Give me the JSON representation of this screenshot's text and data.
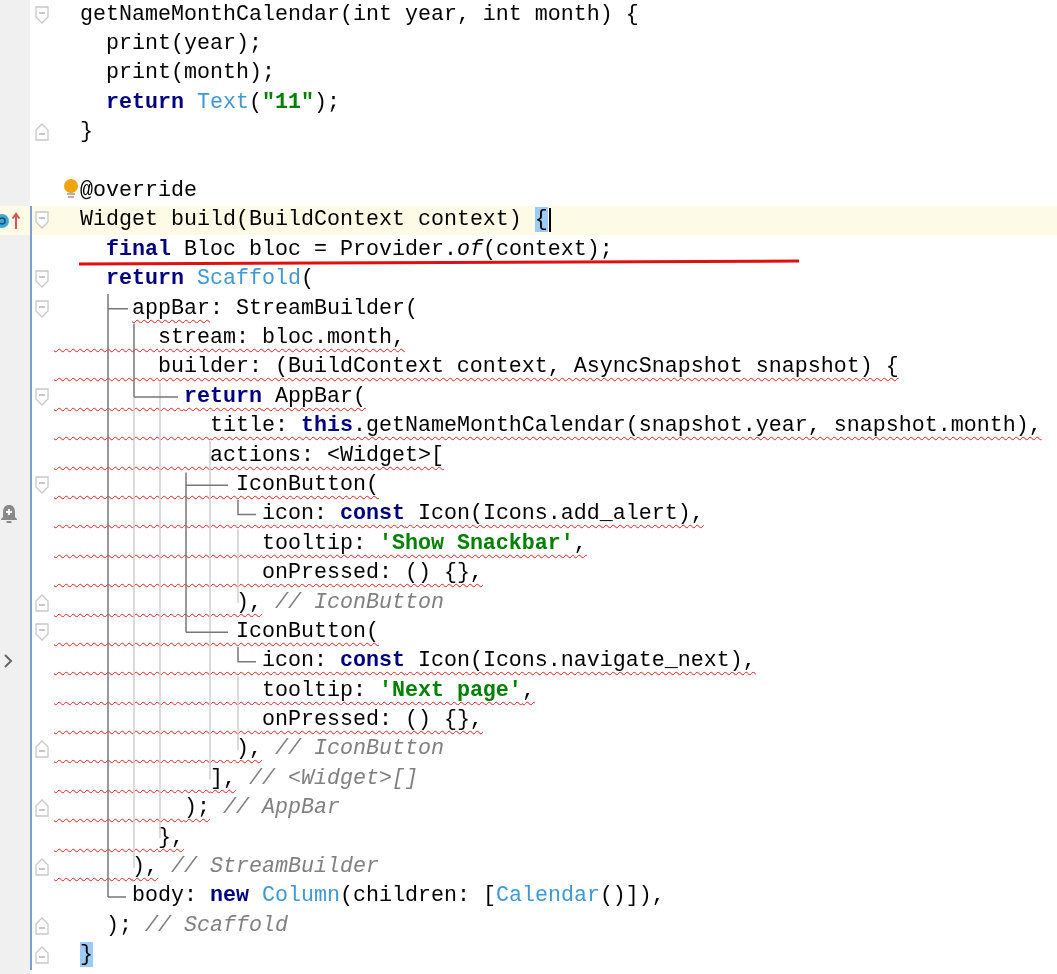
{
  "editor": {
    "lines": [
      {
        "tokens": [
          {
            "text": "  getNameMonthCalendar(int year, int month) {"
          }
        ],
        "fold_start": true,
        "fold_end": false,
        "current": false,
        "changed": false,
        "squiggle": false,
        "intention": false,
        "caret": false
      },
      {
        "tokens": [
          {
            "text": "    print(year);"
          }
        ],
        "fold_start": false,
        "fold_end": false,
        "current": false,
        "changed": false,
        "squiggle": false,
        "intention": false,
        "caret": false
      },
      {
        "tokens": [
          {
            "text": "    print(month);"
          }
        ],
        "fold_start": false,
        "fold_end": false,
        "current": false,
        "changed": false,
        "squiggle": false,
        "intention": false,
        "caret": false
      },
      {
        "tokens": [
          {
            "text": "    return",
            "kind": "keyword"
          },
          {
            "text": " Text",
            "kind": "type"
          },
          {
            "text": "("
          },
          {
            "text": "\"11\"",
            "kind": "string"
          },
          {
            "text": ");"
          }
        ],
        "fold_start": false,
        "fold_end": false,
        "current": false,
        "changed": false,
        "squiggle": false,
        "intention": false,
        "caret": false
      },
      {
        "tokens": [
          {
            "text": "  }"
          }
        ],
        "fold_start": false,
        "fold_end": true,
        "current": false,
        "changed": false,
        "squiggle": false,
        "intention": false,
        "caret": false
      },
      {
        "fold_start": false,
        "fold_end": false,
        "current": false,
        "changed": false,
        "squiggle": false,
        "intention": false,
        "caret": false
      },
      {
        "tokens": [
          {
            "text": "  @override"
          }
        ],
        "fold_start": false,
        "fold_end": false,
        "current": false,
        "changed": false,
        "squiggle": false,
        "intention": true,
        "caret": false
      },
      {
        "tokens": [
          {
            "text": "  Widget build(BuildContext context) "
          },
          {
            "text": "{",
            "kind": "match"
          }
        ],
        "fold_start": true,
        "fold_end": false,
        "current": true,
        "changed": true,
        "squiggle": false,
        "intention": false,
        "caret": true
      },
      {
        "tokens": [
          {
            "text": "    final",
            "kind": "keyword"
          },
          {
            "text": " Bloc bloc = Provider."
          },
          {
            "text": "of",
            "kind": "italic"
          },
          {
            "text": "(context);"
          }
        ],
        "fold_start": false,
        "fold_end": false,
        "current": false,
        "changed": true,
        "squiggle": false,
        "intention": false,
        "caret": false
      },
      {
        "tokens": [
          {
            "text": "    return",
            "kind": "keyword"
          },
          {
            "text": " Scaffold",
            "kind": "type"
          },
          {
            "text": "("
          }
        ],
        "fold_start": true,
        "fold_end": false,
        "current": false,
        "changed": true,
        "squiggle": false,
        "intention": false,
        "caret": false
      },
      {
        "tokens": [
          {
            "text": "      appBar",
            "error": true
          },
          {
            "text": ": StreamBuilder("
          }
        ],
        "fold_start": true,
        "fold_end": false,
        "current": false,
        "changed": true,
        "squiggle": false,
        "intention": false,
        "caret": false
      },
      {
        "tokens": [
          {
            "text": "        stream: bloc.month,"
          }
        ],
        "fold_start": false,
        "fold_end": false,
        "current": false,
        "changed": true,
        "squiggle": true,
        "intention": false,
        "caret": false
      },
      {
        "tokens": [
          {
            "text": "        builder: (BuildContext context, AsyncSnapshot snapshot) {"
          }
        ],
        "fold_start": false,
        "fold_end": false,
        "current": false,
        "changed": true,
        "squiggle": true,
        "intention": false,
        "caret": false
      },
      {
        "tokens": [
          {
            "text": "          return",
            "kind": "keyword"
          },
          {
            "text": " AppBar("
          }
        ],
        "fold_start": true,
        "fold_end": false,
        "current": false,
        "changed": true,
        "squiggle": true,
        "intention": false,
        "caret": false
      },
      {
        "tokens": [
          {
            "text": "            title: "
          },
          {
            "text": "this",
            "kind": "keyword"
          },
          {
            "text": ".getNameMonthCalendar(snapshot.year, snapshot.month),"
          }
        ],
        "fold_start": false,
        "fold_end": false,
        "current": false,
        "changed": true,
        "squiggle": true,
        "intention": false,
        "caret": false
      },
      {
        "tokens": [
          {
            "text": "            actions: <Widget>["
          }
        ],
        "fold_start": false,
        "fold_end": false,
        "current": false,
        "changed": true,
        "squiggle": true,
        "intention": false,
        "caret": false
      },
      {
        "tokens": [
          {
            "text": "              IconButton("
          }
        ],
        "fold_start": true,
        "fold_end": false,
        "current": false,
        "changed": true,
        "squiggle": true,
        "intention": false,
        "caret": false
      },
      {
        "tokens": [
          {
            "text": "                icon: "
          },
          {
            "text": "const",
            "kind": "keyword"
          },
          {
            "text": " Icon(Icons.add_alert),"
          }
        ],
        "fold_start": false,
        "fold_end": false,
        "current": false,
        "changed": true,
        "squiggle": true,
        "intention": false,
        "caret": false
      },
      {
        "tokens": [
          {
            "text": "                tooltip: "
          },
          {
            "text": "'Show Snackbar'",
            "kind": "string"
          },
          {
            "text": ","
          }
        ],
        "fold_start": false,
        "fold_end": false,
        "current": false,
        "changed": true,
        "squiggle": true,
        "intention": false,
        "caret": false
      },
      {
        "tokens": [
          {
            "text": "                onPressed: () {},"
          }
        ],
        "fold_start": false,
        "fold_end": false,
        "current": false,
        "changed": true,
        "squiggle": true,
        "intention": false,
        "caret": false
      },
      {
        "tokens": [
          {
            "text": "              ),"
          },
          {
            "text": " // IconButton",
            "kind": "comment"
          }
        ],
        "fold_start": false,
        "fold_end": true,
        "current": false,
        "changed": true,
        "squiggle": true,
        "intention": false,
        "caret": false
      },
      {
        "tokens": [
          {
            "text": "              IconButton("
          }
        ],
        "fold_start": true,
        "fold_end": false,
        "current": false,
        "changed": true,
        "squiggle": true,
        "intention": false,
        "caret": false
      },
      {
        "tokens": [
          {
            "text": "                icon: "
          },
          {
            "text": "const",
            "kind": "keyword"
          },
          {
            "text": " Icon(Icons.navigate_next),"
          }
        ],
        "fold_start": false,
        "fold_end": false,
        "current": false,
        "changed": true,
        "squiggle": true,
        "intention": false,
        "caret": false
      },
      {
        "tokens": [
          {
            "text": "                tooltip: "
          },
          {
            "text": "'Next page'",
            "kind": "string"
          },
          {
            "text": ","
          }
        ],
        "fold_start": false,
        "fold_end": false,
        "current": false,
        "changed": true,
        "squiggle": true,
        "intention": false,
        "caret": false
      },
      {
        "tokens": [
          {
            "text": "                onPressed: () {},"
          }
        ],
        "fold_start": false,
        "fold_end": false,
        "current": false,
        "changed": true,
        "squiggle": true,
        "intention": false,
        "caret": false
      },
      {
        "tokens": [
          {
            "text": "              ),"
          },
          {
            "text": " // IconButton",
            "kind": "comment"
          }
        ],
        "fold_start": false,
        "fold_end": true,
        "current": false,
        "changed": true,
        "squiggle": true,
        "intention": false,
        "caret": false
      },
      {
        "tokens": [
          {
            "text": "            ],"
          },
          {
            "text": " // <Widget>[]",
            "kind": "comment"
          }
        ],
        "fold_start": false,
        "fold_end": false,
        "current": false,
        "changed": true,
        "squiggle": true,
        "intention": false,
        "caret": false
      },
      {
        "tokens": [
          {
            "text": "          );"
          },
          {
            "text": " // AppBar",
            "kind": "comment"
          }
        ],
        "fold_start": false,
        "fold_end": true,
        "current": false,
        "changed": true,
        "squiggle": true,
        "intention": false,
        "caret": false
      },
      {
        "tokens": [
          {
            "text": "        },"
          }
        ],
        "fold_start": false,
        "fold_end": false,
        "current": false,
        "changed": true,
        "squiggle": true,
        "intention": false,
        "caret": false
      },
      {
        "tokens": [
          {
            "text": "      ),"
          },
          {
            "text": " // StreamBuilder",
            "kind": "comment"
          }
        ],
        "fold_start": false,
        "fold_end": true,
        "current": false,
        "changed": true,
        "squiggle": true,
        "intention": false,
        "caret": false
      },
      {
        "tokens": [
          {
            "text": "      body: "
          },
          {
            "text": "new",
            "kind": "keyword"
          },
          {
            "text": " Column",
            "kind": "type"
          },
          {
            "text": "(children: ["
          },
          {
            "text": "Calendar",
            "kind": "type"
          },
          {
            "text": "()]),"
          }
        ],
        "fold_start": false,
        "fold_end": false,
        "current": false,
        "changed": true,
        "squiggle": false,
        "intention": false,
        "caret": false
      },
      {
        "tokens": [
          {
            "text": "    );"
          },
          {
            "text": " // Scaffold",
            "kind": "comment"
          }
        ],
        "fold_start": false,
        "fold_end": true,
        "current": false,
        "changed": true,
        "squiggle": false,
        "intention": false,
        "caret": false
      },
      {
        "tokens": [
          {
            "text": "  }",
            "kind": "match"
          }
        ],
        "fold_start": false,
        "fold_end": true,
        "current": false,
        "changed": true,
        "squiggle": false,
        "intention": false,
        "caret": false
      }
    ]
  }
}
